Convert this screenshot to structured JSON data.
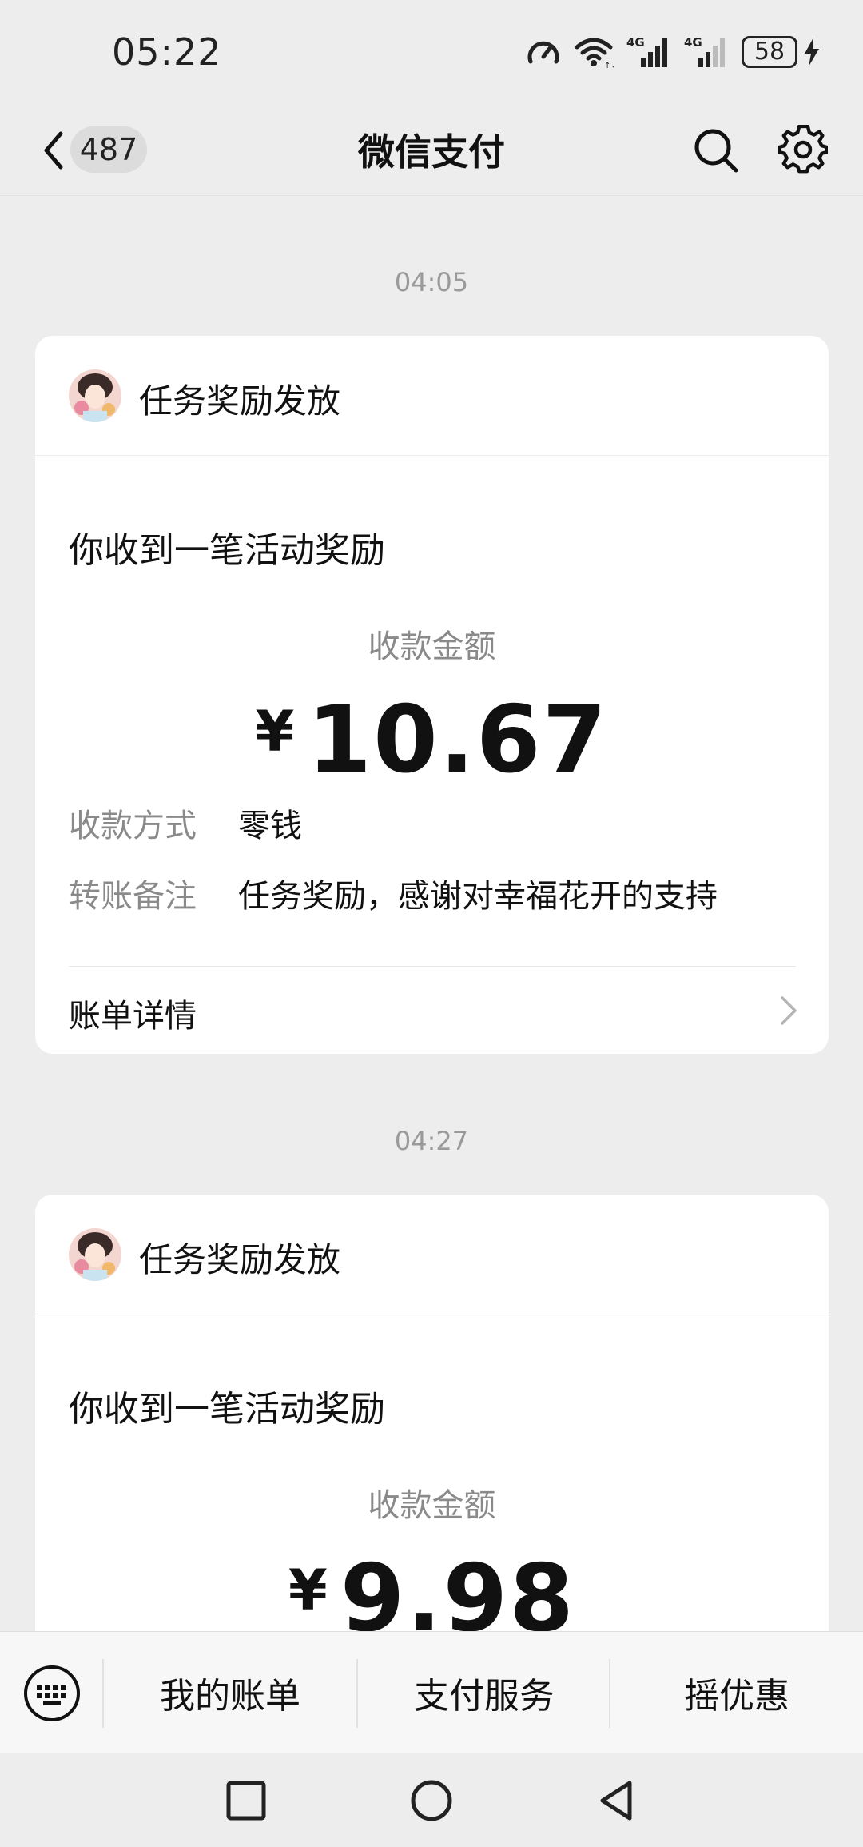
{
  "status_bar": {
    "time": "05:22",
    "icons": [
      "speed-icon",
      "wifi-icon",
      "signal-4g-icon",
      "signal-4g-icon",
      "battery-icon",
      "charging-icon"
    ],
    "network_labels": [
      "4G",
      "4G"
    ],
    "battery": "58"
  },
  "nav": {
    "back_icon": "chevron-left-icon",
    "unread_count": "487",
    "title": "微信支付",
    "search_icon": "search-icon",
    "settings_icon": "gear-icon"
  },
  "messages": [
    {
      "time": "04:05",
      "sender": "任务奖励发放",
      "title": "你收到一笔活动奖励",
      "amount_label": "收款金额",
      "currency": "¥",
      "amount": "10.67",
      "rows": [
        {
          "label": "收款方式",
          "value": "零钱"
        },
        {
          "label": "转账备注",
          "value": "任务奖励，感谢对幸福花开的支持"
        }
      ],
      "detail_label": "账单详情"
    },
    {
      "time": "04:27",
      "sender": "任务奖励发放",
      "title": "你收到一笔活动奖励",
      "amount_label": "收款金额",
      "currency": "¥",
      "amount": "9.98"
    }
  ],
  "bottom_menu": {
    "keyboard_icon": "keyboard-icon",
    "items": [
      "我的账单",
      "支付服务",
      "摇优惠"
    ]
  },
  "system_nav": [
    "square-recent-icon",
    "circle-home-icon",
    "triangle-back-icon"
  ],
  "colors": {
    "background": "#ededed",
    "card": "#ffffff",
    "secondary_text": "#8a8a8a"
  }
}
